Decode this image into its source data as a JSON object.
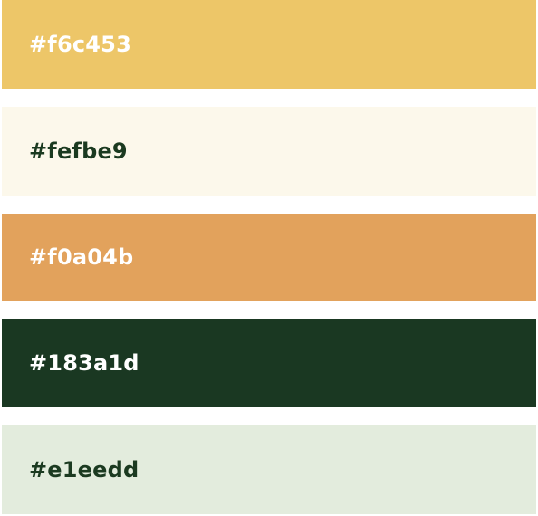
{
  "swatches": [
    {
      "label": "#f6c453",
      "color": "#edc668",
      "text_color": "#ffffff"
    },
    {
      "label": "#fefbe9",
      "color": "#fcf8eb",
      "text_color": "#1b3a20"
    },
    {
      "label": "#f0a04b",
      "color": "#e2a25c",
      "text_color": "#ffffff"
    },
    {
      "label": "#183a1d",
      "color": "#1a3822",
      "text_color": "#ffffff"
    },
    {
      "label": "#e1eedd",
      "color": "#e3ecdd",
      "text_color": "#1b3a20"
    }
  ]
}
